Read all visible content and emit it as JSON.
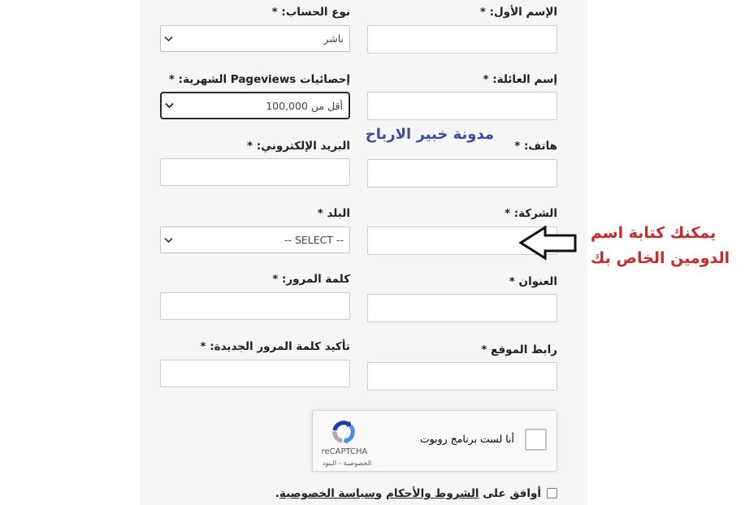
{
  "form": {
    "first_name": {
      "label": "الإسم الأول: *",
      "value": ""
    },
    "account_type": {
      "label": "نوع الحساب: *",
      "selected": "ناشر"
    },
    "last_name": {
      "label": "إسم العائلة: *",
      "value": ""
    },
    "monthly_pageviews": {
      "label": "إحصائيات Pageviews الشهرية: *",
      "selected": "أقل من 100,000"
    },
    "phone": {
      "label": "هاتف: *",
      "value": ""
    },
    "email": {
      "label": "البريد الإلكتروني: *",
      "value": ""
    },
    "company": {
      "label": "الشركة: *",
      "value": ""
    },
    "country": {
      "label": "البلد *",
      "selected": "-- SELECT --"
    },
    "address": {
      "label": "العنوان *",
      "value": ""
    },
    "password": {
      "label": "كلمة المرور: *",
      "value": ""
    },
    "website": {
      "label": "رابط الموقع *",
      "value": ""
    },
    "confirm_password": {
      "label": "تأكيد كلمة المرور الجديدة: *",
      "value": ""
    }
  },
  "recaptcha": {
    "checked": false,
    "label": "أنا لست برنامج روبوت",
    "brand": "reCAPTCHA",
    "privacy_link": "الخصوصية",
    "separator": "-",
    "terms_link": "البنود",
    "icon": "recaptcha-logo-icon"
  },
  "agreement": {
    "checked": false,
    "prefix": "أوافق على",
    "terms_link": "الشروط والأحكام",
    "joiner": "و",
    "privacy_link": "سياسة الخصوصية",
    "suffix": "."
  },
  "annotations": {
    "blog_name": "مدونة خبير الارباح",
    "hint_lines": [
      "يمكنك كتابة اسم",
      "الدومين الخاص بك"
    ],
    "arrow_icon": "arrow-left-icon",
    "blog_name_color": "#3f4ba0",
    "hint_color": "#c62a2a"
  },
  "icons": {
    "select_chevron": "chevron-down-icon"
  },
  "colors": {
    "panel_background": "#f6f6f6",
    "focus_border": "#2b2b2b"
  }
}
